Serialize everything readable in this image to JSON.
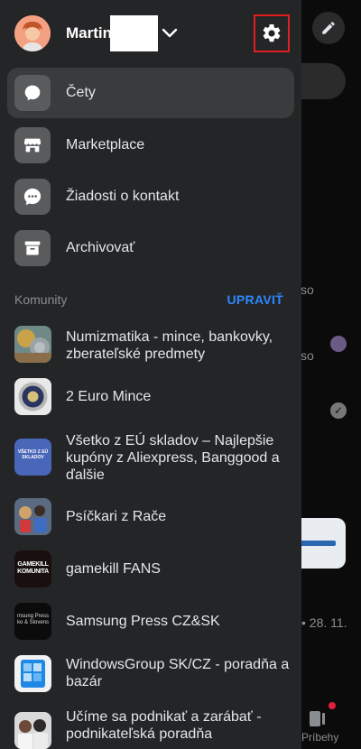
{
  "account": {
    "name": "Martin"
  },
  "menu": [
    {
      "label": "Čety",
      "icon": "chat-bubble-icon",
      "active": true
    },
    {
      "label": "Marketplace",
      "icon": "store-icon",
      "active": false
    },
    {
      "label": "Žiadosti o kontakt",
      "icon": "message-dots-icon",
      "active": false
    },
    {
      "label": "Archivovať",
      "icon": "archive-box-icon",
      "active": false
    }
  ],
  "communities_section": {
    "title": "Komunity",
    "edit_label": "UPRAVIŤ"
  },
  "communities": [
    {
      "name": "Numizmatika - mince, bankovky, zberateľské predmety"
    },
    {
      "name": "2 Euro Mince"
    },
    {
      "name": "Všetko z EÚ skladov – Najlepšie kupóny z Aliexpress, Banggood a ďalšie",
      "thumb_text": "VŠETKO Z EÚ SKLADOV"
    },
    {
      "name": "Psíčkari z Rače"
    },
    {
      "name": "gamekill FANS",
      "thumb_text": "GAMEKILL KOMUNITA"
    },
    {
      "name": "Samsung Press CZ&SK",
      "thumb_text": "msung Press ko & Slovens"
    },
    {
      "name": "WindowsGroup SK/CZ - poradňa a bazár"
    },
    {
      "name": "Učíme sa podnikať a zarábať - podnikateľská poradňa"
    }
  ],
  "background": {
    "fragment_so_1": "so",
    "fragment_so_2": "so",
    "fragment_date": "• 28. 11.",
    "stories_tab": "Príbehy"
  },
  "colors": {
    "drawer": "#242526",
    "accent": "#2d88ff",
    "highlight": "#e0201f"
  }
}
